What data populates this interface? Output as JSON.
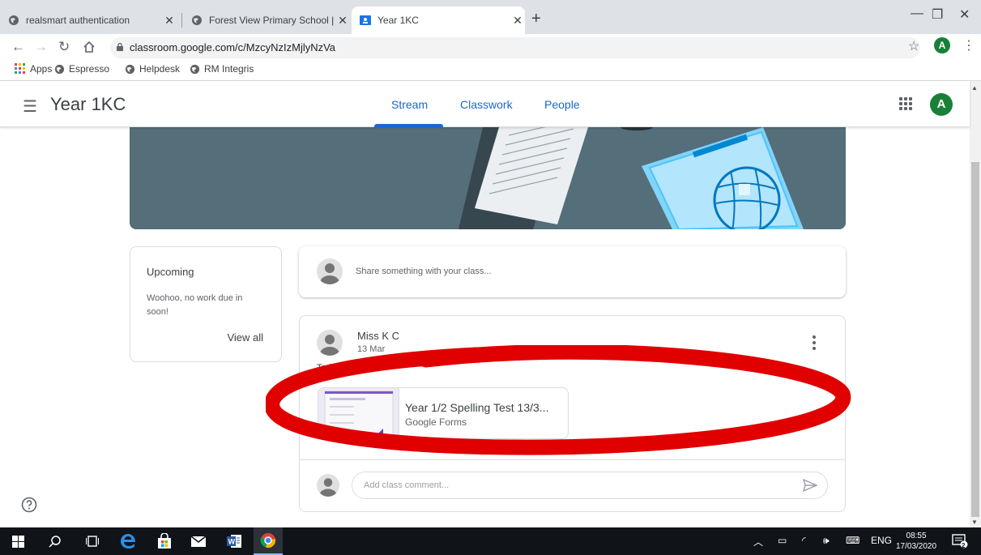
{
  "browser": {
    "tabs": [
      {
        "title": "realsmart authentication",
        "icon": "globe-icon"
      },
      {
        "title": "Forest View Primary School | Aim",
        "icon": "globe-icon"
      },
      {
        "title": "Year 1KC",
        "icon": "google-classroom-icon"
      }
    ],
    "close_glyph": "✕",
    "new_tab_glyph": "+",
    "url": "classroom.google.com/c/MzcyNzIzMjlyNzVa",
    "profile_initial": "A",
    "bookmarks": [
      {
        "label": "Apps"
      },
      {
        "label": "Espresso"
      },
      {
        "label": "Helpdesk"
      },
      {
        "label": "RM Integris"
      }
    ]
  },
  "classroom": {
    "class_name": "Year 1KC",
    "tabs": [
      "Stream",
      "Classwork",
      "People"
    ],
    "active_tab": "Stream",
    "user_initial": "A",
    "upcoming": {
      "title": "Upcoming",
      "text": "Woohoo, no work due in soon!",
      "view_all": "View all"
    },
    "share_placeholder": "Share something with your class...",
    "post": {
      "author": "Miss K C",
      "date": "13 Mar",
      "text": "Today's",
      "attachment_title": "Year 1/2 Spelling Test 13/3...",
      "attachment_type": "Google Forms",
      "comment_placeholder": "Add class comment..."
    }
  },
  "taskbar": {
    "language": "ENG",
    "time": "08:55",
    "date": "17/03/2020",
    "notification_count": "2"
  },
  "colors": {
    "accent": "#1967d2",
    "banner": "#546e7a",
    "annotation": "#e00000",
    "avatar": "#188038"
  }
}
